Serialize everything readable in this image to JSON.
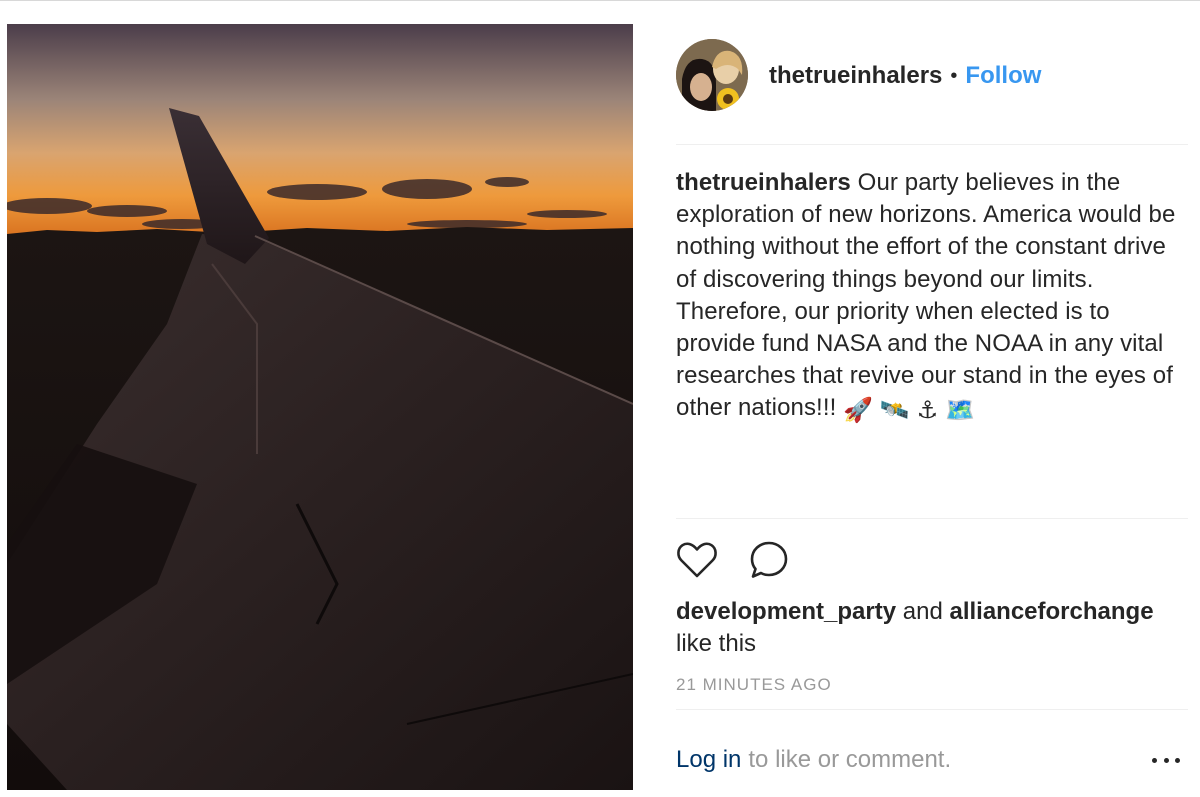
{
  "post": {
    "username": "thetrueinhalers",
    "separator": "•",
    "follow_label": "Follow",
    "caption_author": "thetrueinhalers",
    "caption_text": "Our party believes in the exploration of new horizons. America would be nothing without the effort of the constant drive of discovering things beyond our limits. Therefore, our priority when elected is to provide fund NASA and the NOAA in any vital researches that revive our stand in the eyes of other nations!!!",
    "caption_emojis": [
      "🚀",
      "🛰️",
      "⚓",
      "🗺️"
    ],
    "likes": {
      "user1": "development_party",
      "conjunction": "and",
      "user2": "allianceforchange",
      "suffix": "like this"
    },
    "timestamp": "21 MINUTES AGO",
    "login_link": "Log in",
    "login_suffix": "to like or comment."
  },
  "icons": {
    "like": "heart-outline-icon",
    "comment": "speech-bubble-icon",
    "more": "ellipsis-icon"
  },
  "colors": {
    "text": "#262626",
    "follow": "#3897f0",
    "link": "#003569",
    "muted": "#999999",
    "divider": "#efefef"
  }
}
